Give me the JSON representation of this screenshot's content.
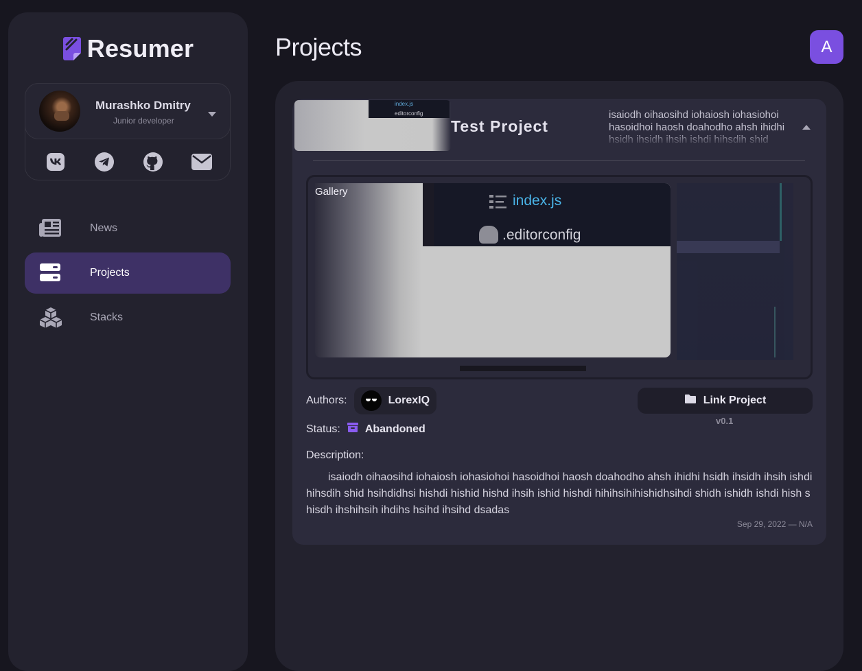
{
  "app": {
    "name": "Resumer"
  },
  "profile": {
    "name": "Murashko Dmitry",
    "role": "Junior developer",
    "socials": [
      "vk-icon",
      "telegram-icon",
      "github-icon",
      "mail-icon"
    ]
  },
  "nav": {
    "items": [
      {
        "label": "News",
        "icon": "newspaper-icon",
        "active": false
      },
      {
        "label": "Projects",
        "icon": "server-icon",
        "active": true
      },
      {
        "label": "Stacks",
        "icon": "cubes-icon",
        "active": false
      }
    ]
  },
  "header": {
    "title": "Projects",
    "user_initial": "A"
  },
  "project": {
    "title": "Test Project",
    "snippet": "isaiodh oihaosihd iohaiosh iohasiohoi hasoidhoi haosh doahodho ahsh ihidhi hsidh ihsidh ihsih ishdi hihsdih shid hsihdidhsi hishdi hishid",
    "thumb_files": [
      "index.js",
      "editorconfig"
    ],
    "gallery_label": "Gallery",
    "gallery_files": [
      "index.js",
      ".editorconfig"
    ],
    "authors_label": "Authors:",
    "author": "LorexIQ",
    "status_label": "Status:",
    "status": "Abandoned",
    "link_label": "Link Project",
    "version": "v0.1",
    "description_label": "Description:",
    "description": "isaiodh oihaosihd iohaiosh iohasiohoi hasoidhoi haosh doahodho ahsh ihidhi hsidh ihsidh ihsih ishdi hihsdih shid hsihdidhsi hishdi hishid hishd ihsih ishid hishdi hihihsihihishidhsihdi shidh ishidh ishdi hish s hisdh ihshihsih ihdihs hsihd ihsihd dsadas",
    "dates": "Sep 29, 2022 — N/A"
  },
  "colors": {
    "accent": "#7a4fe0",
    "active_nav": "#3e3166",
    "background": "#17161f",
    "panel": "#23222e",
    "card": "#2c2b3c"
  }
}
